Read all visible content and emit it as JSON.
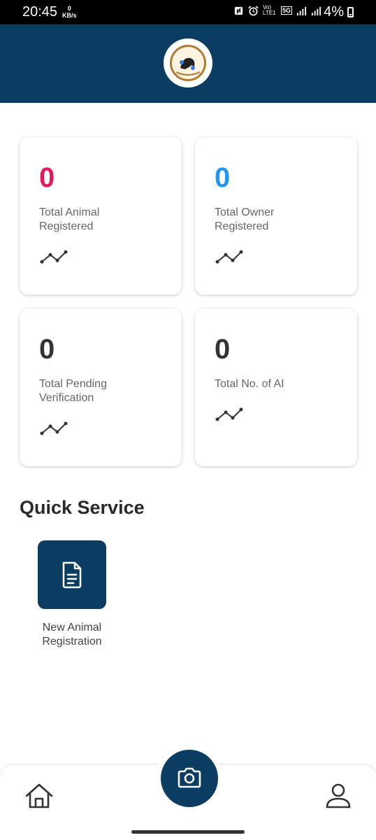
{
  "status_bar": {
    "time": "20:45",
    "speed_value": "0",
    "speed_unit": "KB/s",
    "volte_label": "Vo) LTE1",
    "network": "5G",
    "battery": "4%"
  },
  "stats": [
    {
      "value": "0",
      "label": "Total Animal Registered",
      "color": "#e3195d"
    },
    {
      "value": "0",
      "label": "Total Owner Registered",
      "color": "#2196f3"
    },
    {
      "value": "0",
      "label": "Total Pending Verification",
      "color": "#333333"
    },
    {
      "value": "0",
      "label": "Total No. of AI",
      "color": "#333333"
    }
  ],
  "quick_service": {
    "title": "Quick Service",
    "items": [
      {
        "label": "New Animal Registration",
        "icon": "document-icon"
      }
    ]
  },
  "bottom_nav": {
    "items": [
      {
        "icon": "home-icon"
      },
      {
        "icon": "camera-icon"
      },
      {
        "icon": "user-icon"
      }
    ]
  },
  "colors": {
    "primary": "#0b3c61",
    "accent_pink": "#e3195d",
    "accent_blue": "#2196f3"
  }
}
